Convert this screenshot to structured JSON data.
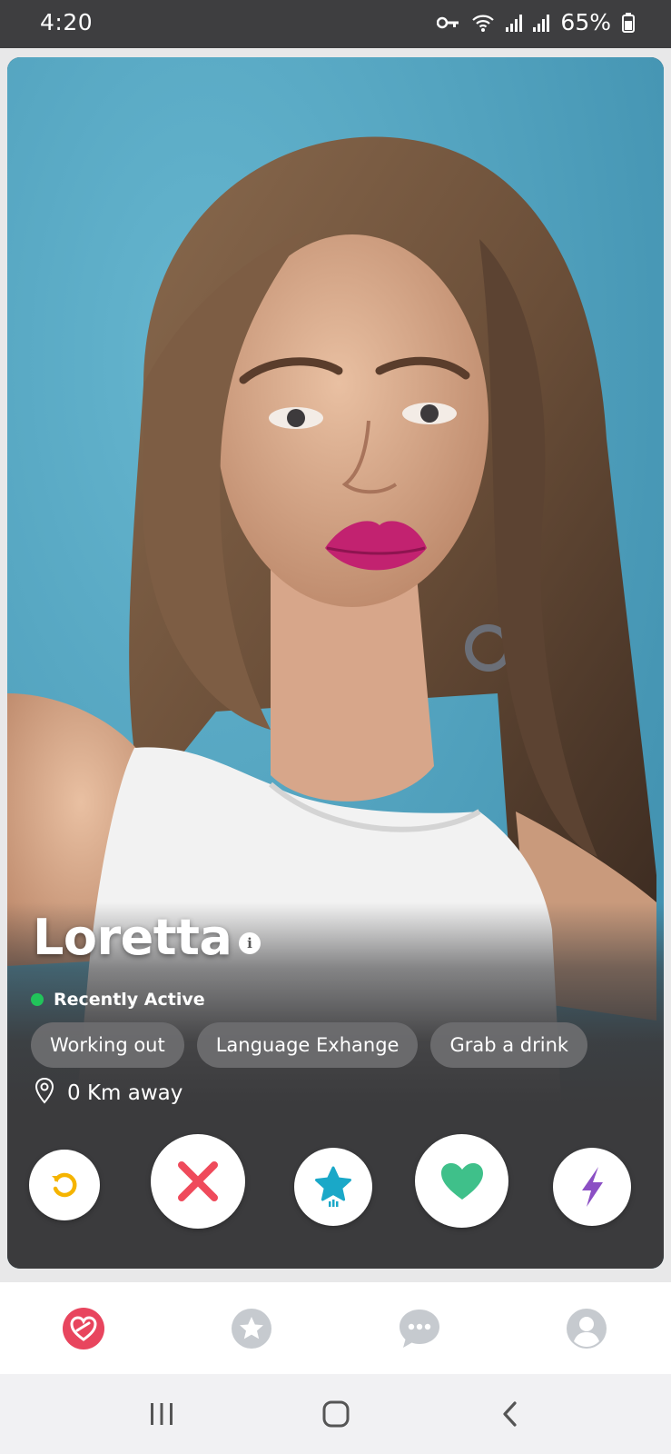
{
  "status_bar": {
    "time": "4:20",
    "battery": "65%",
    "icons": [
      "vpn-key-icon",
      "wifi-icon",
      "signal-icon",
      "signal-icon",
      "battery-icon"
    ]
  },
  "profile": {
    "name": "Loretta",
    "info_icon_glyph": "i",
    "status": "Recently Active",
    "interests": [
      "Working out",
      "Language Exhange",
      "Grab a drink"
    ],
    "distance": "0 Km away"
  },
  "actions": [
    {
      "name": "rewind",
      "icon": "rewind-icon",
      "color": "#f5b400"
    },
    {
      "name": "nope",
      "icon": "close-x-icon",
      "color": "#ef4a5b"
    },
    {
      "name": "super-like",
      "icon": "star-icon",
      "color": "#1aa8c8"
    },
    {
      "name": "like",
      "icon": "heart-icon",
      "color": "#3fc08a"
    },
    {
      "name": "boost",
      "icon": "lightning-icon",
      "color": "#8b4fc4"
    }
  ],
  "bottom_nav": [
    {
      "name": "discover",
      "icon": "flame-heart-icon",
      "active": true,
      "color": "#e8455e"
    },
    {
      "name": "top-picks",
      "icon": "star-icon",
      "active": false,
      "color": "#c6cacf"
    },
    {
      "name": "messages",
      "icon": "chat-bubble-icon",
      "active": false,
      "color": "#c6cacf"
    },
    {
      "name": "profile",
      "icon": "profile-icon",
      "active": false,
      "color": "#c6cacf"
    }
  ],
  "system_nav": [
    "recent-apps-icon",
    "home-icon",
    "back-icon"
  ],
  "colors": {
    "card_bg": "#3b3b3d",
    "photo_bg": "#4fa2be",
    "active_dot": "#21c45a"
  }
}
